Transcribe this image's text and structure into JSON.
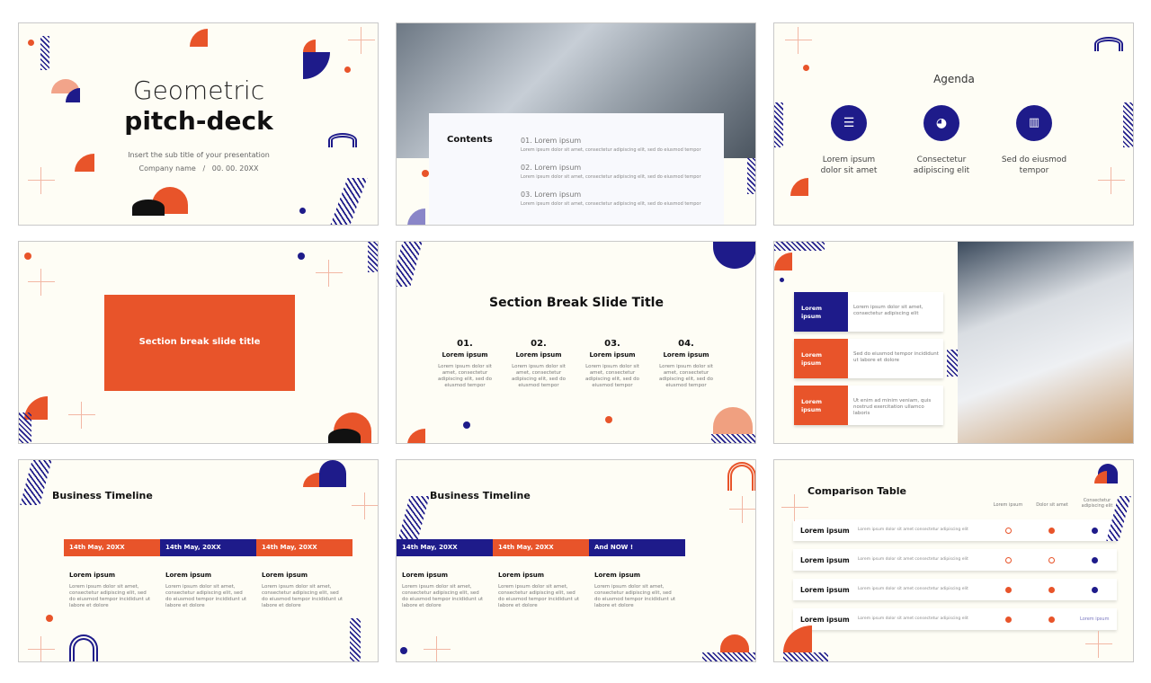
{
  "colors": {
    "orange": "#e8542a",
    "navy": "#1e1b8a",
    "background": "#fefdf5"
  },
  "slide1": {
    "title_line1": "Geometric",
    "title_line2": "pitch-deck",
    "subtitle": "Insert the sub title of your presentation",
    "company": "Company name   /   00. 00. 20XX"
  },
  "slide2": {
    "heading": "Contents",
    "items": [
      {
        "title": "01. Lorem ipsum",
        "text": "Lorem ipsum dolor sit amet, consectetur adipiscing elit, sed do eiusmod tempor"
      },
      {
        "title": "02. Lorem ipsum",
        "text": "Lorem ipsum dolor sit amet, consectetur adipiscing elit, sed do eiusmod tempor"
      },
      {
        "title": "03. Lorem ipsum",
        "text": "Lorem ipsum dolor sit amet, consectetur adipiscing elit, sed do eiusmod tempor"
      }
    ]
  },
  "slide3": {
    "title": "Agenda",
    "items": [
      {
        "icon": "clipboard-icon",
        "line1": "Lorem ipsum",
        "line2": "dolor sit amet"
      },
      {
        "icon": "pie-chart-icon",
        "line1": "Consectetur",
        "line2": "adipiscing elit"
      },
      {
        "icon": "bar-chart-icon",
        "line1": "Sed do eiusmod",
        "line2": "tempor"
      }
    ]
  },
  "slide4": {
    "title": "Section break slide title"
  },
  "slide5": {
    "title": "Section Break Slide Title",
    "items": [
      {
        "num": "01.",
        "title": "Lorem ipsum",
        "text": "Lorem ipsum dolor sit amet, consectetur adipiscing elit, sed do eiusmod tempor"
      },
      {
        "num": "02.",
        "title": "Lorem ipsum",
        "text": "Lorem ipsum dolor sit amet, consectetur adipiscing elit, sed do eiusmod tempor"
      },
      {
        "num": "03.",
        "title": "Lorem ipsum",
        "text": "Lorem ipsum dolor sit amet, consectetur adipiscing elit, sed do eiusmod tempor"
      },
      {
        "num": "04.",
        "title": "Lorem ipsum",
        "text": "Lorem ipsum dolor sit amet, consectetur adipiscing elit, sed do eiusmod tempor"
      }
    ]
  },
  "slide6": {
    "items": [
      {
        "label": "Lorem ipsum",
        "text": "Lorem ipsum dolor sit amet, consectetur adipiscing elit"
      },
      {
        "label": "Lorem ipsum",
        "text": "Sed do eiusmod tempor incididunt ut labore et dolore"
      },
      {
        "label": "Lorem ipsum",
        "text": "Ut enim ad minim veniam, quis nostrud exercitation ullamco laboris"
      }
    ]
  },
  "slide7": {
    "title": "Business Timeline",
    "dates": [
      "14th May, 20XX",
      "14th May, 20XX",
      "14th May, 20XX"
    ],
    "items": [
      {
        "title": "Lorem ipsum",
        "text": "Lorem ipsum dolor sit amet, consectetur adipiscing elit, sed do eiusmod tempor incididunt ut labore et dolore"
      },
      {
        "title": "Lorem ipsum",
        "text": "Lorem ipsum dolor sit amet, consectetur adipiscing elit, sed do eiusmod tempor incididunt ut labore et dolore"
      },
      {
        "title": "Lorem ipsum",
        "text": "Lorem ipsum dolor sit amet, consectetur adipiscing elit, sed do eiusmod tempor incididunt ut labore et dolore"
      }
    ]
  },
  "slide8": {
    "title": "Business Timeline",
    "dates": [
      "14th May, 20XX",
      "14th May, 20XX",
      "And NOW !"
    ],
    "items": [
      {
        "title": "Lorem ipsum",
        "text": "Lorem ipsum dolor sit amet, consectetur adipiscing elit, sed do eiusmod tempor incididunt ut labore et dolore"
      },
      {
        "title": "Lorem ipsum",
        "text": "Lorem ipsum dolor sit amet, consectetur adipiscing elit, sed do eiusmod tempor incididunt ut labore et dolore"
      },
      {
        "title": "Lorem ipsum",
        "text": "Lorem ipsum dolor sit amet, consectetur adipiscing elit, sed do eiusmod tempor incididunt ut labore et dolore"
      }
    ]
  },
  "slide9": {
    "title": "Comparison Table",
    "columns": [
      "Lorem ipsum",
      "Dolor sit amet",
      "Consectetur adipiscing elit"
    ],
    "rows": [
      {
        "label": "Lorem ipsum",
        "text": "Lorem ipsum dolor sit amet consectetur adipiscing elit",
        "cells": [
          "orange-outline",
          "orange-filled",
          "navy-filled"
        ]
      },
      {
        "label": "Lorem ipsum",
        "text": "Lorem ipsum dolor sit amet consectetur adipiscing elit",
        "cells": [
          "orange-outline",
          "orange-outline",
          "navy-filled"
        ]
      },
      {
        "label": "Lorem ipsum",
        "text": "Lorem ipsum dolor sit amet consectetur adipiscing elit",
        "cells": [
          "orange-filled",
          "orange-filled",
          "navy-filled"
        ]
      },
      {
        "label": "Lorem ipsum",
        "text": "Lorem ipsum dolor sit amet consectetur adipiscing elit",
        "cells": [
          "orange-filled",
          "orange-filled",
          "Lorem ipsum"
        ]
      }
    ]
  }
}
